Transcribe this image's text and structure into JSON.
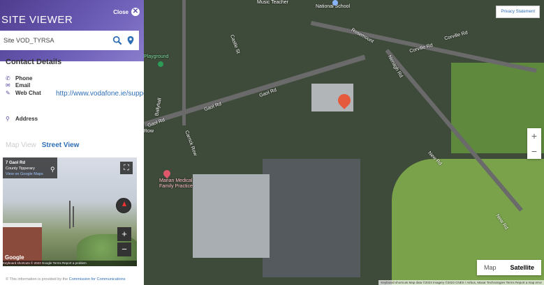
{
  "panel": {
    "title": "SITE VIEWER",
    "close_label": "Close",
    "search_value": "Site VOD_TYRSA",
    "section_title": "Contact Details",
    "contact": {
      "phone_label": "Phone",
      "email_label": "Email",
      "webchat_label": "Web Chat",
      "webchat_url": "http://www.vodafone.ie/support/",
      "address_label": "Address"
    },
    "tabs": {
      "map": "Map View",
      "street": "Street View"
    },
    "streetview": {
      "place": "7 Gaol Rd",
      "county": "County Tipperary",
      "link": "View on Google Maps",
      "google": "Google",
      "footer": "Keyboard shortcuts  © 2023 Google  Terms  Report a problem"
    },
    "disclaimer_prefix": "© This information is provided by the",
    "disclaimer_link": "Commission for Communications"
  },
  "map": {
    "privacy": "Privacy Statement",
    "type_map": "Map",
    "type_satellite": "Satellite",
    "footer": "Keyboard shortcuts  Map data ©2023 Imagery ©2023 CNES / Airbus, Maxar Technologies  Terms  Report a map error",
    "labels": {
      "gaol_rd_1": "Gaol Rd",
      "gaol_rd_2": "Gaol Rd",
      "gaol_rd_3": "Gaol Rd",
      "row": "Row",
      "rosemount": "Rosemount",
      "corville_rd_1": "Corville Rd",
      "corville_rd_2": "Corville Rd",
      "nenagh_rd": "Nenagh Rd",
      "new_rd_1": "New Rd",
      "new_rd_2": "New Rd",
      "castle_st": "Castle St",
      "carrick_row": "Carrick Row",
      "ballyhall": "Ballyhall",
      "playground": "Playground",
      "school": "National School",
      "music_teacher": "Music Teacher",
      "medical": "Marian Medical Family Practice"
    }
  },
  "colors": {
    "accent": "#5a4aa0",
    "link": "#2f6fb5",
    "pin": "#e55a3c"
  }
}
